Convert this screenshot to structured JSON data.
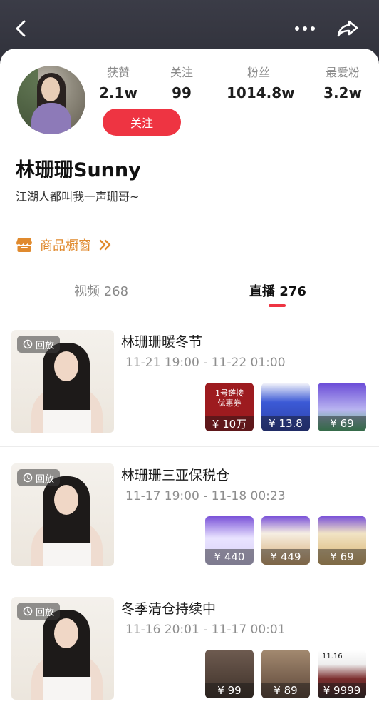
{
  "header": {
    "back_icon": "chevron-left-icon",
    "more_icon": "more-horizontal-icon",
    "share_icon": "share-icon"
  },
  "profile": {
    "stats": [
      {
        "label": "获赞",
        "value": "2.1w"
      },
      {
        "label": "关注",
        "value": "99"
      },
      {
        "label": "粉丝",
        "value": "1014.8w"
      },
      {
        "label": "最爱粉",
        "value": "3.2w"
      }
    ],
    "follow_label": "关注",
    "name": "林珊珊Sunny",
    "bio": "江湖人都叫我一声珊哥~"
  },
  "shop": {
    "label": "商品橱窗",
    "icon": "store-icon",
    "accent": "#e08a2e"
  },
  "tabs": [
    {
      "label": "视频 268",
      "active": false
    },
    {
      "label": "直播 276",
      "active": true
    }
  ],
  "accent": "#ee3442",
  "lives": [
    {
      "replay_label": "回放",
      "title": "林珊珊暖冬节",
      "time": "11-21 19:00 - 11-22 01:00",
      "products": [
        {
          "price": "¥ 10万",
          "label": "1号链接\n优惠券"
        },
        {
          "price": "¥ 13.8"
        },
        {
          "price": "¥ 69"
        }
      ]
    },
    {
      "replay_label": "回放",
      "title": "林珊珊三亚保税仓",
      "time": "11-17 19:00 - 11-18 00:23",
      "products": [
        {
          "price": "¥ 440"
        },
        {
          "price": "¥ 449"
        },
        {
          "price": "¥ 69"
        }
      ]
    },
    {
      "replay_label": "回放",
      "title": "冬季清仓持续中",
      "time": "11-16 20:01 - 11-17 00:01",
      "products": [
        {
          "price": "¥ 99"
        },
        {
          "price": "¥ 89"
        },
        {
          "price": "¥ 9999",
          "label": "11.16"
        }
      ]
    }
  ]
}
